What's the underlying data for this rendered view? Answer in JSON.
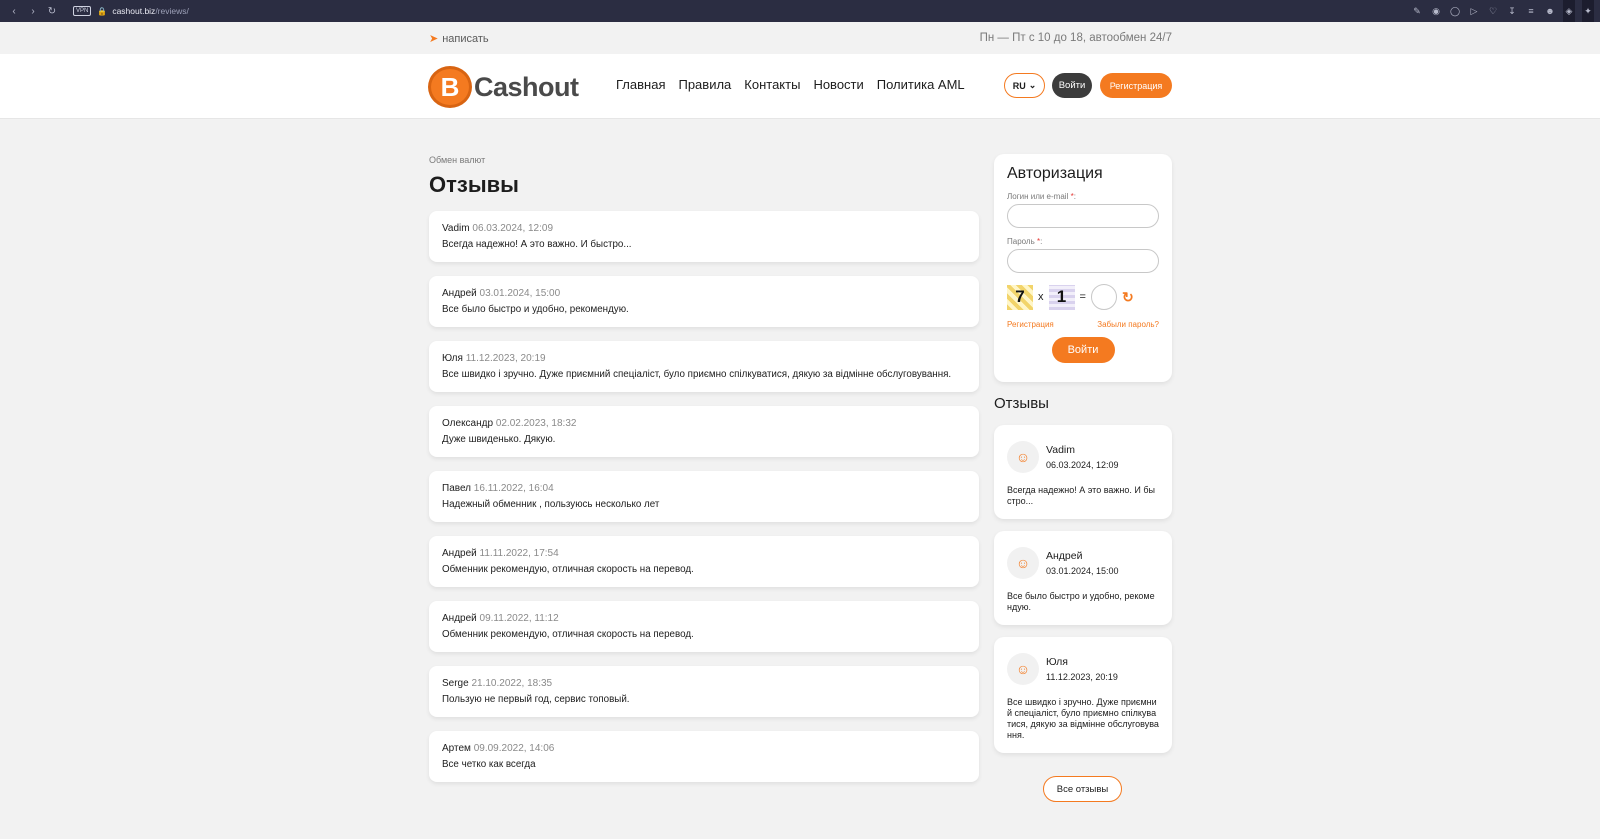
{
  "browser": {
    "vpn": "VPN",
    "url_host": "cashout.biz",
    "url_path": "/reviews/"
  },
  "topbar": {
    "write_label": "написать",
    "hours": "Пн — Пт с 10 до 18, автообмен 24/7"
  },
  "header": {
    "logo_text": "Cashout",
    "logo_letter": "B",
    "nav": [
      "Главная",
      "Правила",
      "Контакты",
      "Новости",
      "Политика AML"
    ],
    "lang": "RU",
    "login": "Войти",
    "register": "Регистрация"
  },
  "main": {
    "breadcrumb": "Обмен валют",
    "title": "Отзывы",
    "reviews": [
      {
        "author": "Vadim",
        "date": "06.03.2024, 12:09",
        "text": "Всегда надежно! А это важно. И быстро..."
      },
      {
        "author": "Андрей",
        "date": "03.01.2024, 15:00",
        "text": "Все было быстро и удобно, рекомендую."
      },
      {
        "author": "Юля",
        "date": "11.12.2023, 20:19",
        "text": "Все швидко і зручно. Дуже приємний спеціаліст, було приємно спілкуватися, дякую за відмінне обслуговування."
      },
      {
        "author": "Олександр",
        "date": "02.02.2023, 18:32",
        "text": "Дуже швиденько. Дякую."
      },
      {
        "author": "Павел",
        "date": "16.11.2022, 16:04",
        "text": "Надежный обменник , пользуюсь несколько лет"
      },
      {
        "author": "Андрей",
        "date": "11.11.2022, 17:54",
        "text": "Обменник рекомендую, отличная скорость на перевод."
      },
      {
        "author": "Андрей",
        "date": "09.11.2022, 11:12",
        "text": "Обменник рекомендую, отличная скорость на перевод."
      },
      {
        "author": "Serge",
        "date": "21.10.2022, 18:35",
        "text": "Пользую не первый год, сервис топовый."
      },
      {
        "author": "Артем",
        "date": "09.09.2022, 14:06",
        "text": "Все четко как всегда"
      }
    ]
  },
  "auth": {
    "title": "Авторизация",
    "login_label": "Логин или e-mail",
    "password_label": "Пароль",
    "required_mark": "*",
    "captcha_a": "7",
    "captcha_op": "x",
    "captcha_b": "1",
    "captcha_eq": "=",
    "register_link": "Регистрация",
    "forgot_link": "Забыли пароль?",
    "submit": "Войти"
  },
  "sidebar": {
    "title": "Отзывы",
    "reviews": [
      {
        "author": "Vadim",
        "date": "06.03.2024, 12:09",
        "text": "Всегда надежно! А это важно. И быстро..."
      },
      {
        "author": "Андрей",
        "date": "03.01.2024, 15:00",
        "text": "Все было быстро и удобно, рекомендую."
      },
      {
        "author": "Юля",
        "date": "11.12.2023, 20:19",
        "text": "Все швидко і зручно. Дуже приємний спеціаліст, було приємно спілкуватися, дякую за відмінне обслуговування."
      }
    ],
    "all_reviews": "Все отзывы"
  },
  "colors": {
    "accent": "#f47a20",
    "dark_button": "#3c3c3c",
    "browser_bar": "#2b2d42"
  },
  "icons": [
    "back-icon",
    "forward-icon",
    "reload-icon",
    "lock-icon",
    "paper-plane-icon",
    "chevron-down-icon",
    "refresh-icon",
    "user-icon"
  ]
}
